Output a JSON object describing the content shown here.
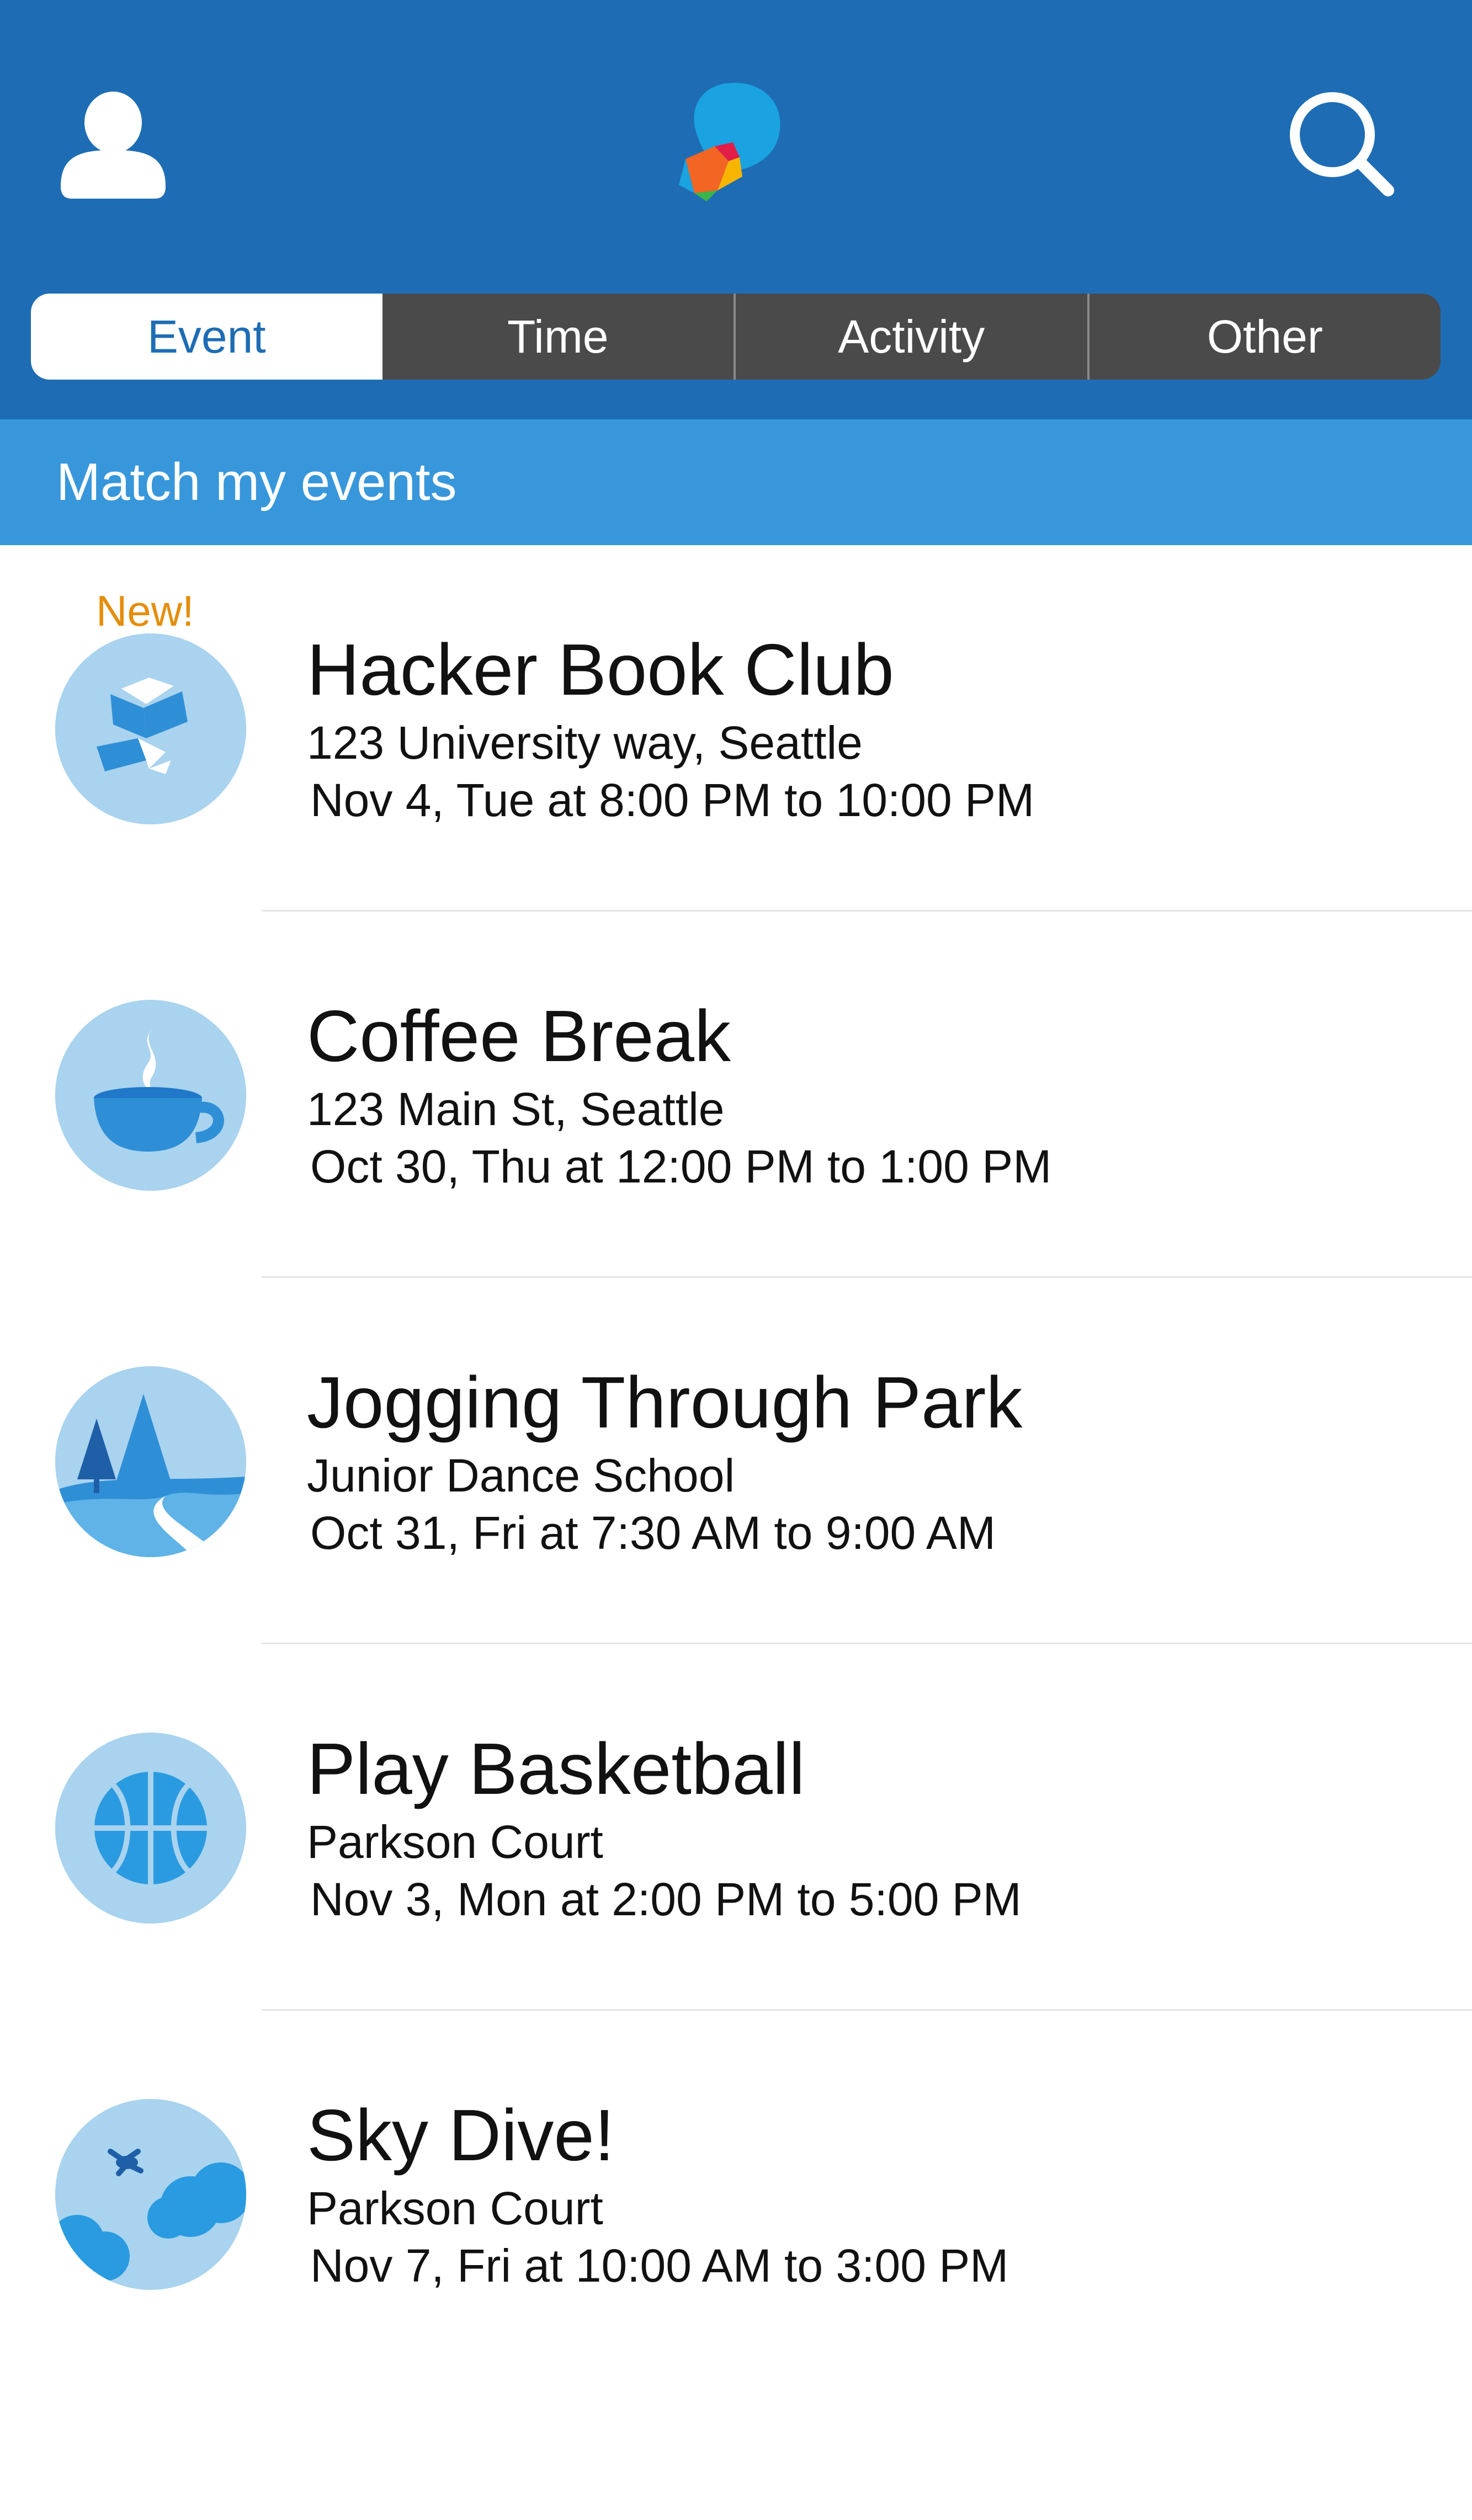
{
  "header": {
    "profile_icon": "user-icon",
    "logo_icon": "app-logo-icon",
    "search_icon": "search-icon",
    "colors": {
      "brand_blue": "#1e6db4",
      "section_blue": "#3897db",
      "tab_dark": "#4a4a4a",
      "badge_orange": "#e58e0b"
    }
  },
  "tabs": [
    {
      "label": "Event",
      "active": true
    },
    {
      "label": "Time",
      "active": false
    },
    {
      "label": "Activity",
      "active": false
    },
    {
      "label": "Other",
      "active": false
    }
  ],
  "section": {
    "title": "Match my events"
  },
  "events": [
    {
      "badge": "New!",
      "icon": "book-icon",
      "title": "Hacker Book Club",
      "address": "123 University way, Seattle",
      "time": "Nov 4, Tue at 8:00 PM to 10:00 PM"
    },
    {
      "icon": "coffee-cup-icon",
      "title": "Coffee Break",
      "address": "123 Main St, Seattle",
      "time": "Oct 30, Thu at 12:00 PM to 1:00 PM"
    },
    {
      "icon": "park-trees-icon",
      "title": "Jogging Through Park",
      "address": "Junior Dance School",
      "time": "Oct 31, Fri at 7:30 AM to 9:00 AM"
    },
    {
      "icon": "basketball-icon",
      "title": "Play Basketball",
      "address": "Parkson Court",
      "time": "Nov 3, Mon at 2:00 PM to 5:00 PM"
    },
    {
      "icon": "skydiver-icon",
      "title": "Sky Dive!",
      "address": "Parkson Court",
      "time": "Nov 7, Fri at 10:00 AM to 3:00 PM"
    }
  ]
}
